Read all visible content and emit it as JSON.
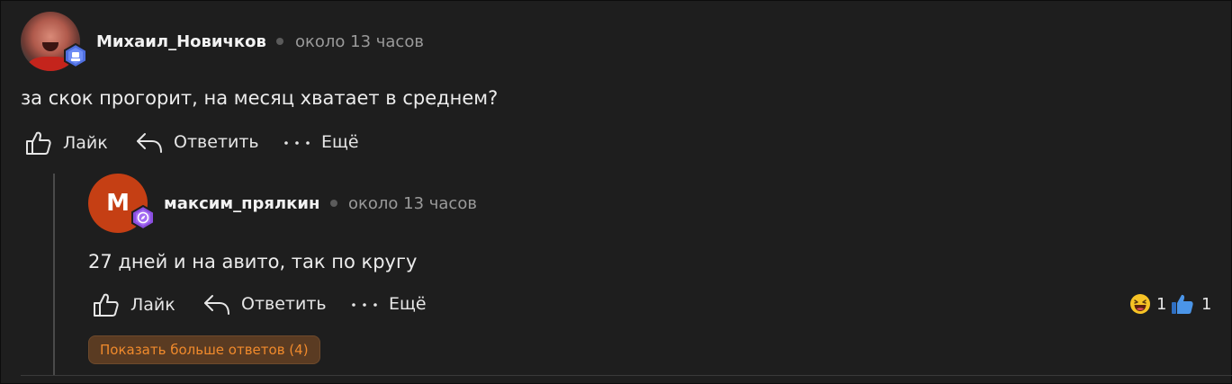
{
  "comment": {
    "author": "Михаил_Новичков",
    "time": "около 13 часов",
    "text": "за скок прогорит, на месяц хватает в среднем?",
    "actions": {
      "like": "Лайк",
      "reply": "Ответить",
      "more": "Ещё"
    },
    "avatar_icon": "user-photo",
    "badge_icon": "rank-badge-icon"
  },
  "reply": {
    "author": "максим_прялкин",
    "avatar_letter": "M",
    "time": "около 13 часов",
    "text": "27 дней и на авито, так по кругу",
    "actions": {
      "like": "Лайк",
      "reply": "Ответить",
      "more": "Ещё"
    },
    "reactions": [
      {
        "icon": "laughing-emoji-icon",
        "count": "1"
      },
      {
        "icon": "thumbs-up-emoji-icon",
        "count": "1"
      }
    ],
    "badge_icon": "compass-badge-icon"
  },
  "show_more_label": "Показать больше ответов (4)",
  "colors": {
    "background": "#1e1e1e",
    "accent_orange": "#f08a2c",
    "avatar_red": "#c53f14",
    "badge_blue": "#4f6fe0",
    "badge_purple": "#8b4fe0"
  }
}
